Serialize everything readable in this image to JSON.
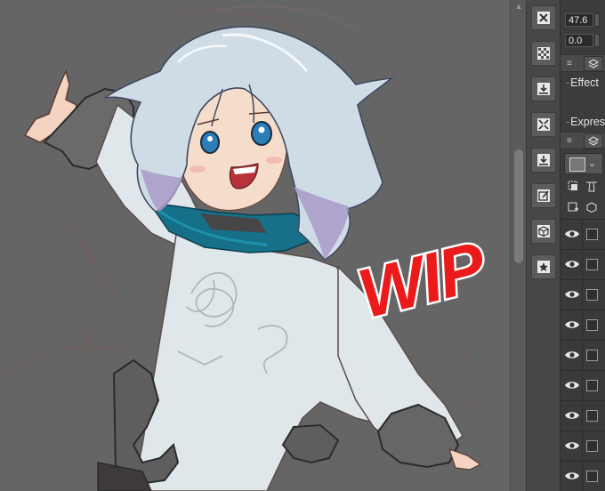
{
  "window": {
    "title": ""
  },
  "canvas": {
    "overlay_text": "WIP",
    "overlay_color": "#ec1b1b",
    "background": "#656565"
  },
  "toolbar": {
    "buttons": [
      {
        "name": "close-sketch-icon"
      },
      {
        "name": "checkerboard-icon"
      },
      {
        "name": "import-icon"
      },
      {
        "name": "transform-icon"
      },
      {
        "name": "export-icon"
      },
      {
        "name": "edit-image-icon"
      },
      {
        "name": "3d-cube-icon"
      },
      {
        "name": "favorite-star-icon"
      }
    ]
  },
  "properties": {
    "value_1": "47.6",
    "value_2": "0.0",
    "effect_label": "Effect",
    "expression_label": "Expres"
  },
  "layers": {
    "rows": 9
  }
}
